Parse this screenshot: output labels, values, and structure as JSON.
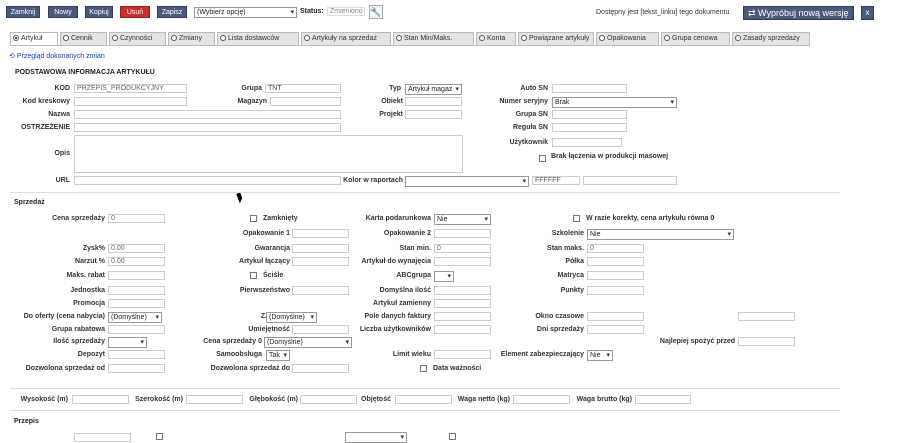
{
  "toolbar": {
    "close_label": "Zamknij",
    "new_label": "Nowy",
    "copy_label": "Kopiuj",
    "delete_label": "Usuń",
    "save_label": "Zapisz",
    "options_value": "(Wybierz opcję)",
    "status_label": "Status:",
    "status_value": "Zmieniono",
    "notice_text": "Dostępny jest [tekst_linku] tego dokumentu",
    "try_new_label": "Wypróbuj nową wersję",
    "close_x": "x"
  },
  "tabs": [
    {
      "label": "Artykuł",
      "active": true
    },
    {
      "label": "Cennik"
    },
    {
      "label": "Czynności"
    },
    {
      "label": "Zmiany"
    },
    {
      "label": "Lista dostawców"
    },
    {
      "label": "Artykuły na sprzedaż"
    },
    {
      "label": "Stan Min/Maks."
    },
    {
      "label": "Konta"
    },
    {
      "label": "Powiązane artykuły"
    },
    {
      "label": "Opakowania"
    },
    {
      "label": "Grupa cenowa"
    },
    {
      "label": "Zasady sprzedaży"
    }
  ],
  "history_link": "Przegląd dokonanych zmian",
  "basic": {
    "title": "PODSTAWOWA INFORMACJA ARTYKUŁU",
    "kod_label": "KOD",
    "kod_value": "PRZEPIS_PRODUKCYJNY",
    "grupa_label": "Grupa",
    "grupa_value": "TNT",
    "typ_label": "Typ",
    "typ_value": "Artykuł magaz",
    "auto_sn_label": "Auto SN",
    "kod_kreskowy_label": "Kod kreskowy",
    "magazyn_label": "Magazyn",
    "obiekt_label": "Obiekt",
    "numer_seryjny_label": "Numer seryjny",
    "numer_seryjny_value": "Brak",
    "nazwa_label": "Nazwa",
    "projekt_label": "Projekt",
    "grupa_sn_label": "Grupa SN",
    "ostrzezenie_label": "OSTRZEŻENIE",
    "regula_sn_label": "Reguła SN",
    "uzytkownik_label": "Użytkownik",
    "opis_label": "Opis",
    "brak_label": "Brak łączenia w produkcji masowej",
    "url_label": "URL",
    "kolor_label": "Kolor w raportach",
    "kolor_value": "FFFFFF"
  },
  "sales": {
    "title": "Sprzedaż",
    "cena_label": "Cena sprzedaży",
    "cena_value": "0",
    "zamkniety_label": "Zamknięty",
    "karta_label": "Karta podarunkowa",
    "karta_value": "Nie",
    "korekta_label": "W razie korekty, cena artykułu równa 0",
    "opakowanie1_label": "Opakowanie 1",
    "opakowanie2_label": "Opakowanie 2",
    "szkolenie_label": "Szkolenie",
    "szkolenie_value": "Nie",
    "zysk_label": "Zysk%",
    "zysk_value": "0.00",
    "gwarancja_label": "Gwarancja",
    "stan_min_label": "Stan min.",
    "stan_min_value": "0",
    "stan_maks_label": "Stan maks.",
    "stan_maks_value": "0",
    "narzut_label": "Narzut %",
    "narzut_value": "0.00",
    "artykul_laczacy_label": "Artykuł łączący",
    "artykul_wynajecia_label": "Artykuł do wynajęcia",
    "polka_label": "Półka",
    "maks_rabat_label": "Maks. rabat",
    "scisle_label": "Ściśle",
    "abc_label": "ABCgrupa",
    "matryca_label": "Matryca",
    "jednostka_label": "Jednostka",
    "pierwszenstwo_label": "Pierwszeństwo",
    "domyslna_ilosc_label": "Domyślna ilość",
    "punkty_label": "Punkty",
    "promocja_label": "Promocja",
    "artykul_zamienny_label": "Artykuł zamienny",
    "do_oferty_label": "Do oferty (cena nabycia)",
    "do_oferty_value": "(Domyślne)",
    "zasoby_label": "ZASOBY",
    "zasoby_value": "(Domyślne)",
    "pole_danych_label": "Pole danych faktury",
    "okno_label": "Okno czasowe",
    "grupa_rabatowa_label": "Grupa rabatowa",
    "umiejetnosc_label": "Umiejętność",
    "liczba_label": "Liczba użytkowników",
    "dni_label": "Dni sprzedaży",
    "ilosc_label": "Ilość sprzedaży",
    "cena0_label": "Cena sprzedaży 0",
    "cena0_value": "(Domyślne)",
    "najlepiej_label": "Najlepiej spożyć przed",
    "depozyt_label": "Depozyt",
    "samoobsluga_label": "Samoobsługa",
    "samoobsluga_value": "Tak",
    "limit_label": "Limit wieku",
    "element_label": "Element zabezpieczający",
    "element_value": "Nie",
    "dozwolona_od_label": "Dozwolona sprzedaż od",
    "dozwolona_do_label": "Dozwolona sprzedaż do",
    "data_label": "Data ważności"
  },
  "dims": {
    "wysokosc_label": "Wysokość (m)",
    "szerokosc_label": "Szerokość (m)",
    "glebokosc_label": "Głębokość (m)",
    "objetosc_label": "Objętość",
    "netto_label": "Waga netto (kg)",
    "brutto_label": "Waga brutto (kg)"
  },
  "recipe": {
    "title": "Przepis"
  }
}
